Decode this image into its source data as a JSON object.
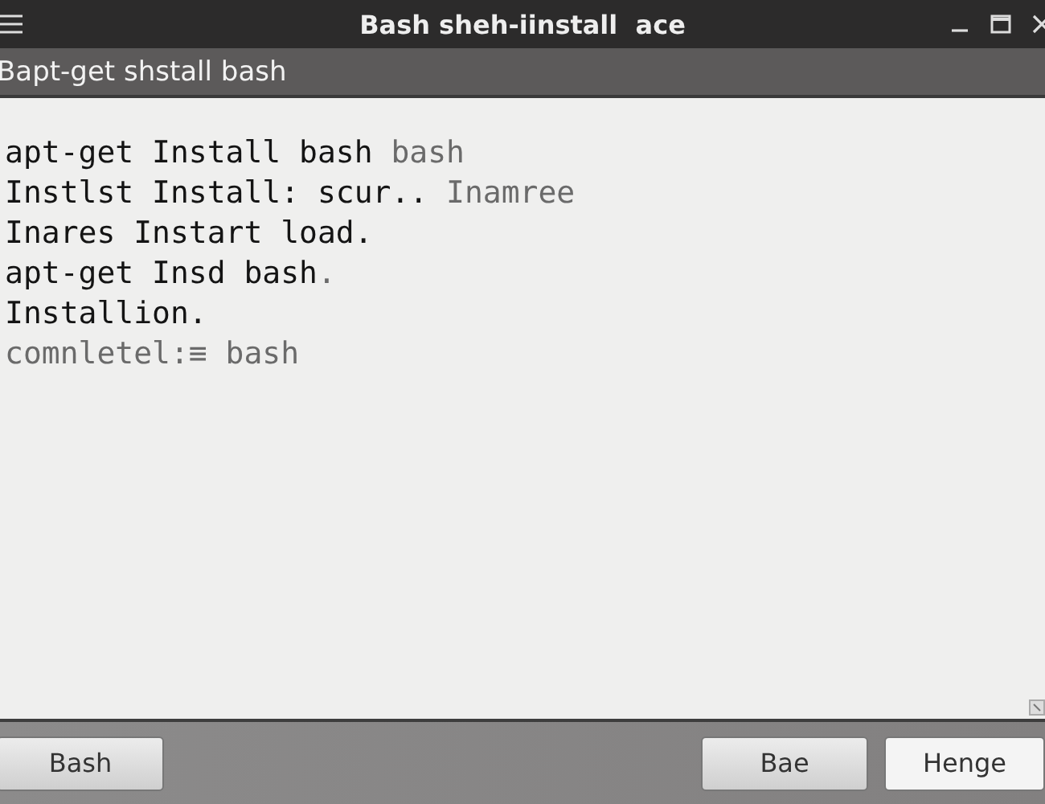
{
  "window": {
    "title": "Bash sheh-iinstall  ace"
  },
  "command_bar": {
    "text": "Bapt-get shstall bash"
  },
  "terminal": {
    "lines": [
      [
        {
          "text": "apt-get Install bash ",
          "dim": false
        },
        {
          "text": "bash",
          "dim": true
        }
      ],
      [
        {
          "text": "Instlst Install: scur.. ",
          "dim": false
        },
        {
          "text": "Inamree",
          "dim": true
        }
      ],
      [
        {
          "text": "Inares Instart load.",
          "dim": false
        }
      ],
      [
        {
          "text": "apt-get Insd bash",
          "dim": false
        },
        {
          "text": ".",
          "dim": true
        }
      ],
      [
        {
          "text": "Installion.",
          "dim": false
        }
      ],
      [
        {
          "text": "comnletel:≡ bash",
          "dim": true
        }
      ]
    ]
  },
  "left_buttons": [
    "Bash"
  ],
  "right_buttons": [
    "Bae",
    "Henge"
  ]
}
